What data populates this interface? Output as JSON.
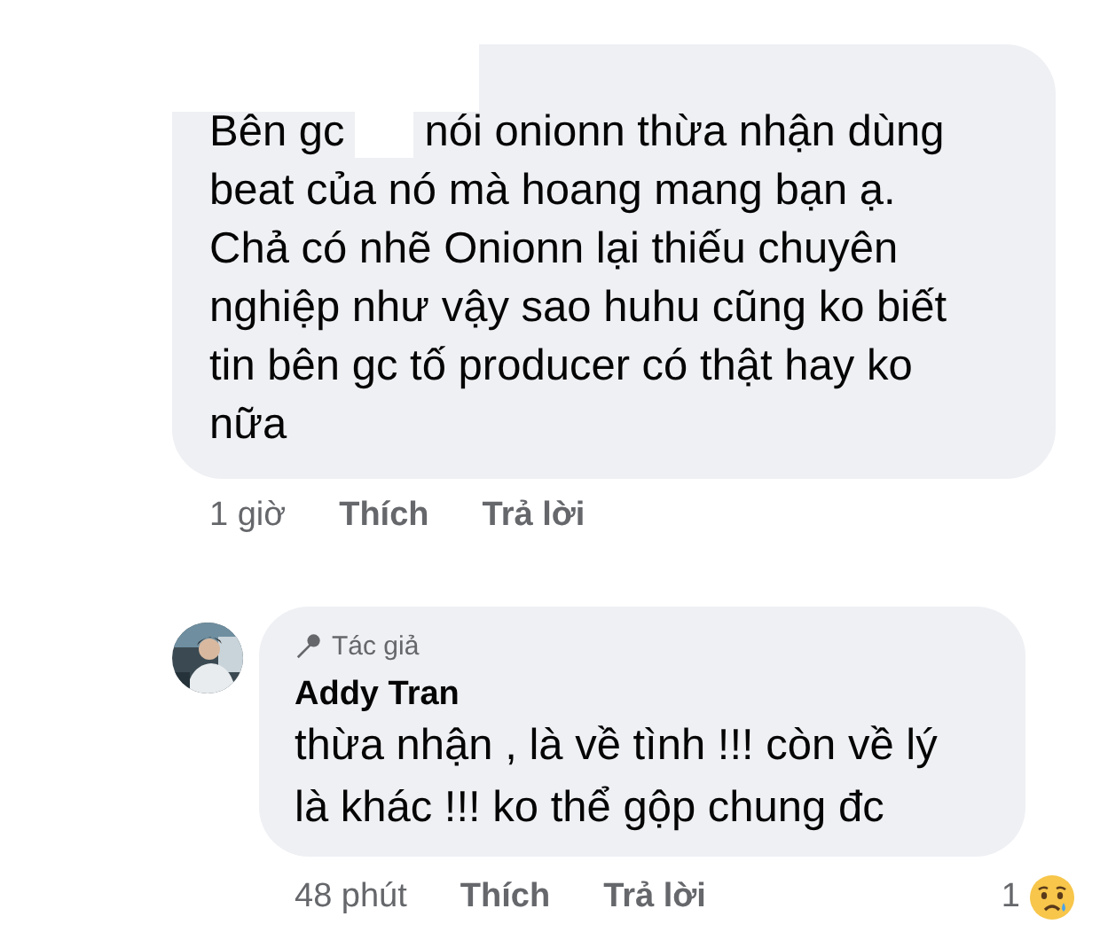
{
  "comments": [
    {
      "kind": "reply-target",
      "body_first_line": {
        "before": "Bên gc",
        "redacted": true,
        "after": "nói onionn thừa nhận dùng"
      },
      "body_lines": [
        "beat của nó mà hoang mang bạn ạ.",
        "Chả có nhẽ Onionn lại thiếu chuyên",
        "nghiệp như vậy sao huhu cũng ko biết",
        "tin bên gc tố producer có thật hay ko",
        "nữa"
      ],
      "time": "1 giờ",
      "actions": [
        "Thích",
        "Trả lời"
      ]
    },
    {
      "kind": "author",
      "badge": "Tác giả",
      "name": "Addy Tran",
      "body_lines": [
        "thừa nhận , là về tình !!! còn về lý",
        "là khác !!! ko thể gộp chung đc"
      ],
      "time": "48 phút",
      "actions": [
        "Thích",
        "Trả lời"
      ],
      "reaction_count": "1"
    }
  ]
}
